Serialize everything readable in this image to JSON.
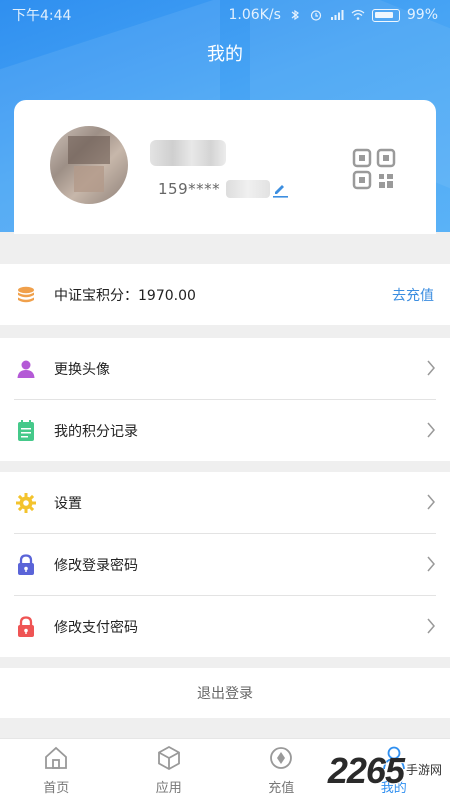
{
  "status_bar": {
    "time": "下午4:44",
    "speed": "1.06K/s",
    "battery": "99%"
  },
  "page_title": "我的",
  "profile": {
    "phone_prefix": "159****"
  },
  "points_section": {
    "label": "中证宝积分：1970.00",
    "action": "去充值"
  },
  "account_section": [
    {
      "label": "更换头像",
      "icon": "person-icon",
      "color": "#b45ad6"
    },
    {
      "label": "我的积分记录",
      "icon": "note-icon",
      "color": "#45c98a"
    }
  ],
  "settings_section": [
    {
      "label": "设置",
      "icon": "gear-icon",
      "color": "#f3c32d"
    },
    {
      "label": "修改登录密码",
      "icon": "lock-icon",
      "color": "#5a64d8"
    },
    {
      "label": "修改支付密码",
      "icon": "lock-icon",
      "color": "#ef5454"
    }
  ],
  "logout_label": "退出登录",
  "tabs": [
    {
      "label": "首页",
      "icon": "home-icon",
      "active": false
    },
    {
      "label": "应用",
      "icon": "box-icon",
      "active": false
    },
    {
      "label": "充值",
      "icon": "recharge-icon",
      "active": false
    },
    {
      "label": "我的",
      "icon": "user-icon",
      "active": true
    }
  ],
  "watermark": {
    "main": "2265",
    "sub": "手游网"
  },
  "colors": {
    "header_blue": "#3b9af2",
    "accent_blue": "#3c8ee0",
    "points_orange": "#f0a04b"
  }
}
